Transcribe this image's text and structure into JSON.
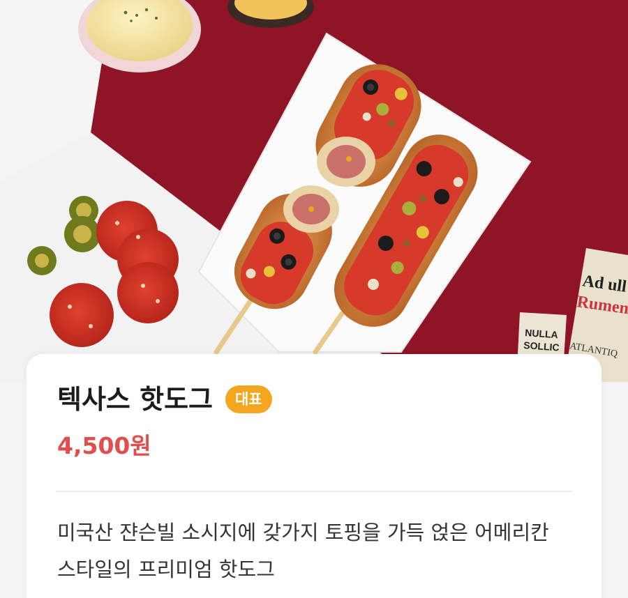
{
  "menu": {
    "name": "텍사스 핫도그",
    "badge": "대표",
    "price": "4,500원",
    "description": "미국산 쟌슨빌 소시지에 갖가지 토핑을 가득 얹은 어메리칸 스타일의 프리미엄 핫도그"
  },
  "photo": {
    "newspaper_lines": [
      "Ad ull",
      "Rumen",
      "NULLA",
      "SOLLIC",
      "ATLANTIQ"
    ]
  },
  "colors": {
    "price": "#e24d4d",
    "badge": "#f5a51f",
    "backdrop": "#8f1426"
  }
}
